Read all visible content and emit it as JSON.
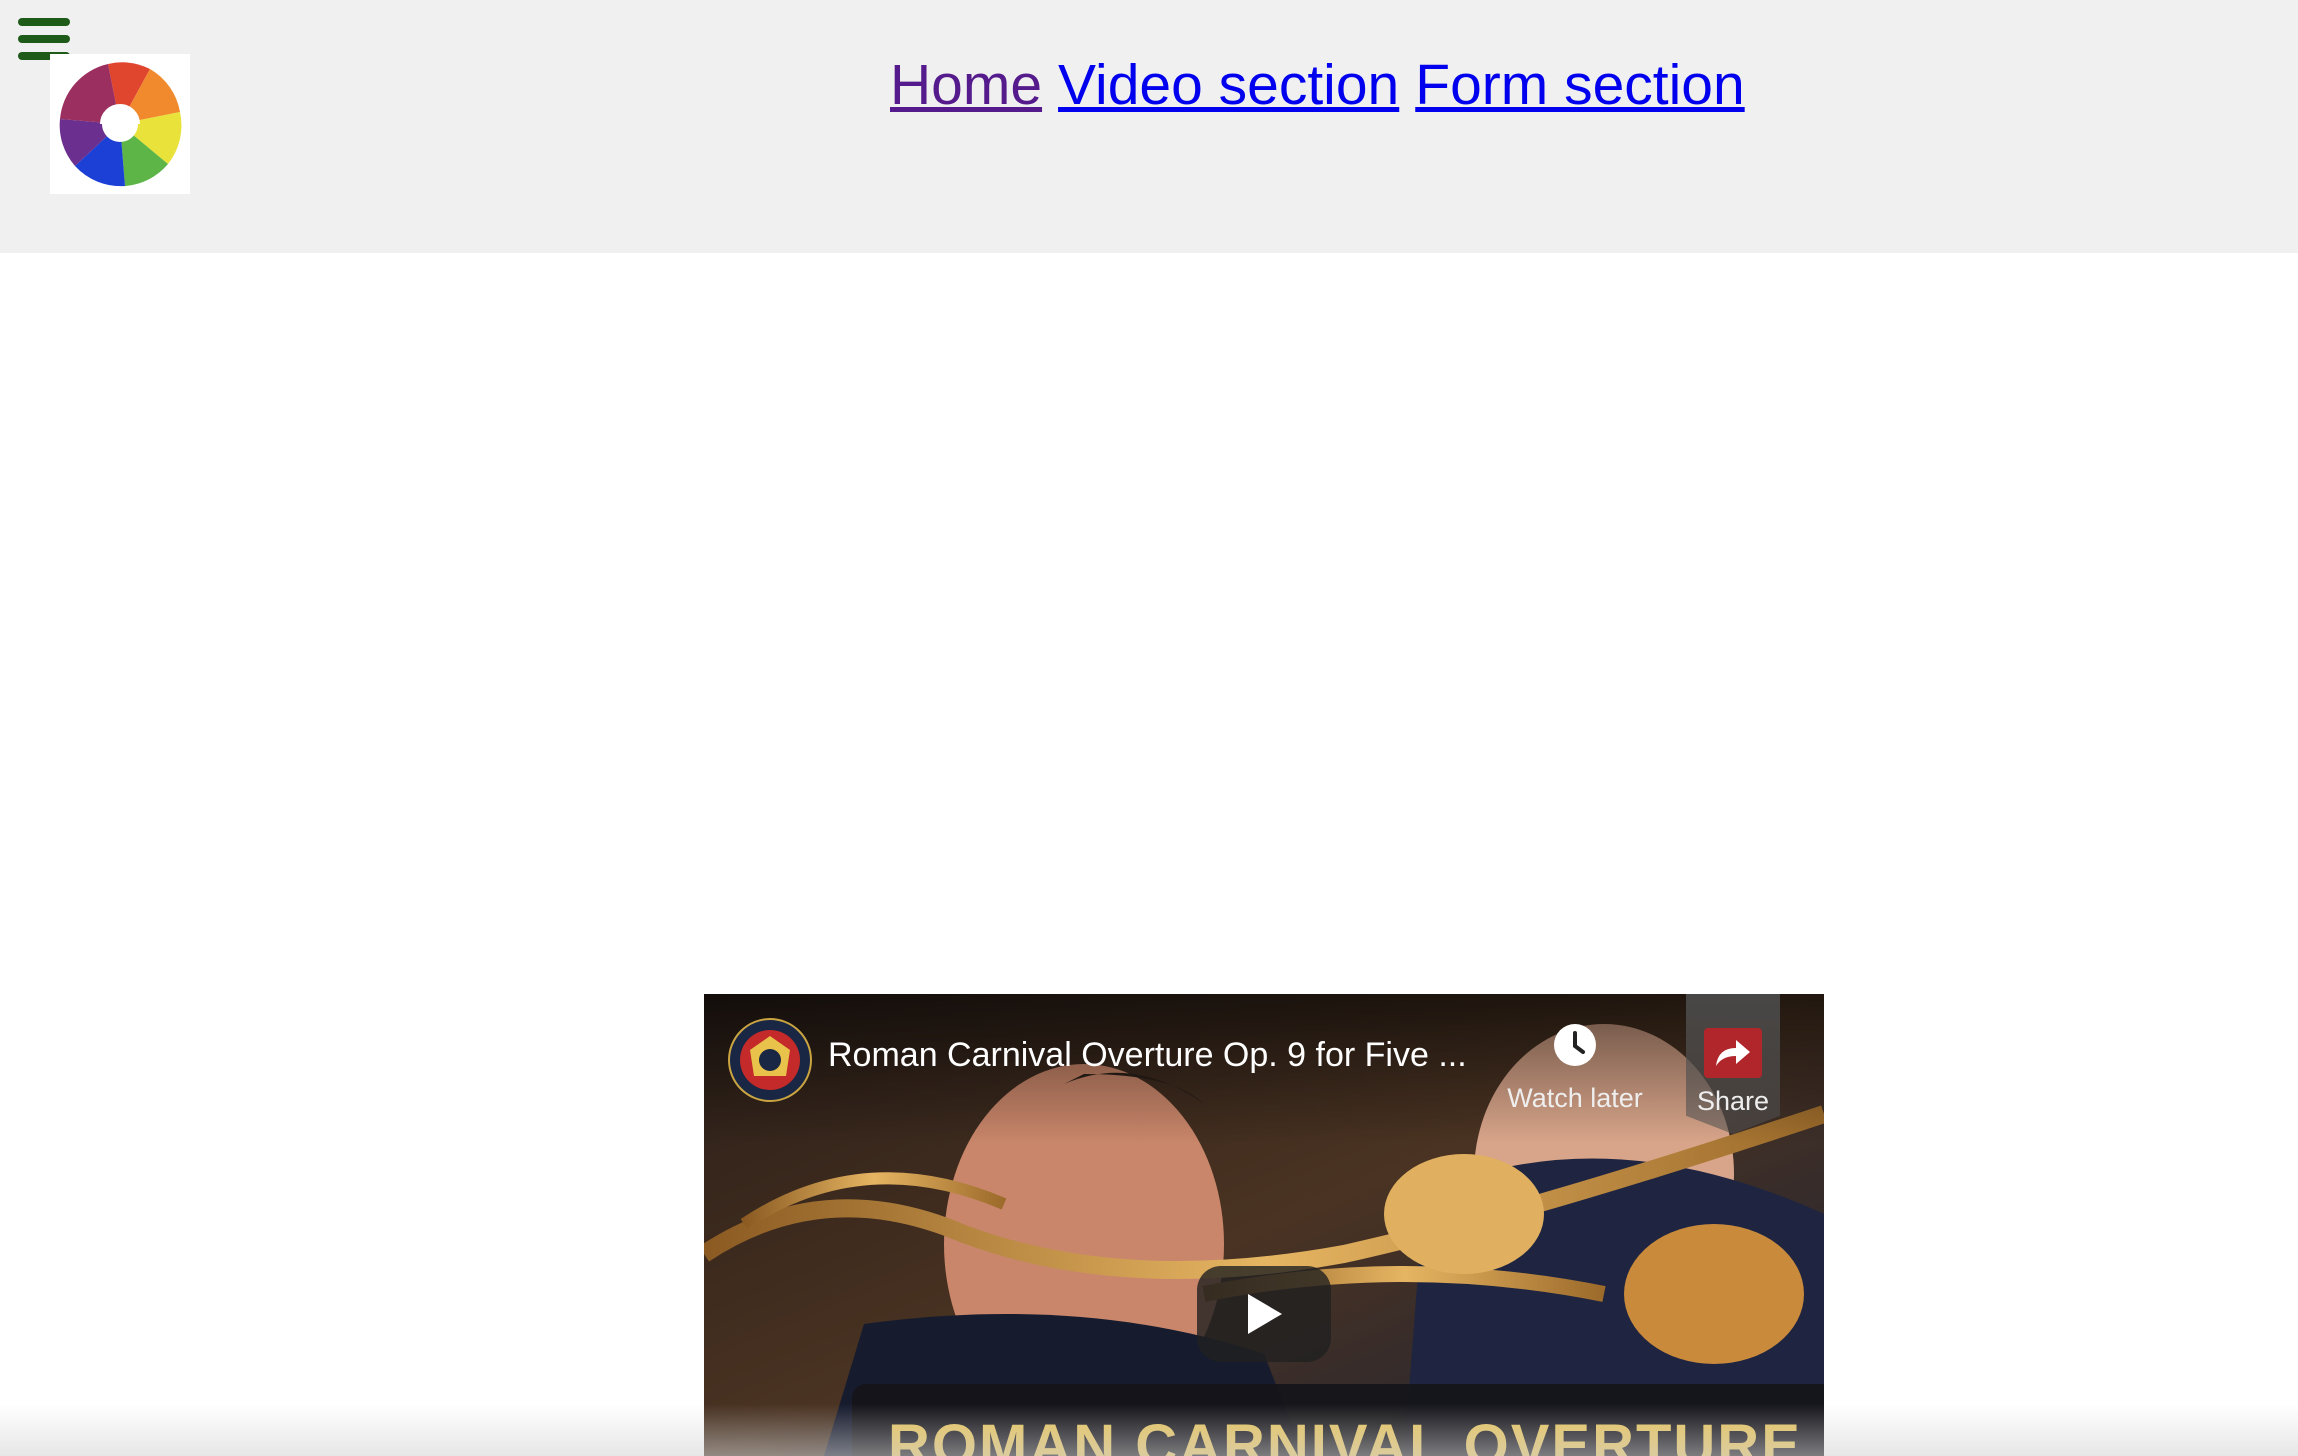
{
  "header": {
    "menu_icon": "hamburger-menu-icon",
    "logo_icon": "rainbow-swirl-logo",
    "nav": [
      {
        "label": "Home",
        "state": "visited"
      },
      {
        "label": "Video section",
        "state": "link"
      },
      {
        "label": "Form section",
        "state": "link"
      }
    ]
  },
  "video": {
    "title": "Roman Carnival Overture Op. 9 for Five ...",
    "watch_later_label": "Watch later",
    "share_label": "Share",
    "banner_text": "ROMAN CARNIVAL OVERTURE",
    "icons": {
      "channel": "channel-avatar",
      "watch_later": "clock-icon",
      "share": "share-arrow-icon",
      "play": "play-icon"
    }
  },
  "colors": {
    "header_bg": "#f0f0f0",
    "menu_green": "#1e5a18",
    "visited_link": "#551a8b",
    "link": "#0000ee",
    "banner_text": "#e6c560"
  }
}
